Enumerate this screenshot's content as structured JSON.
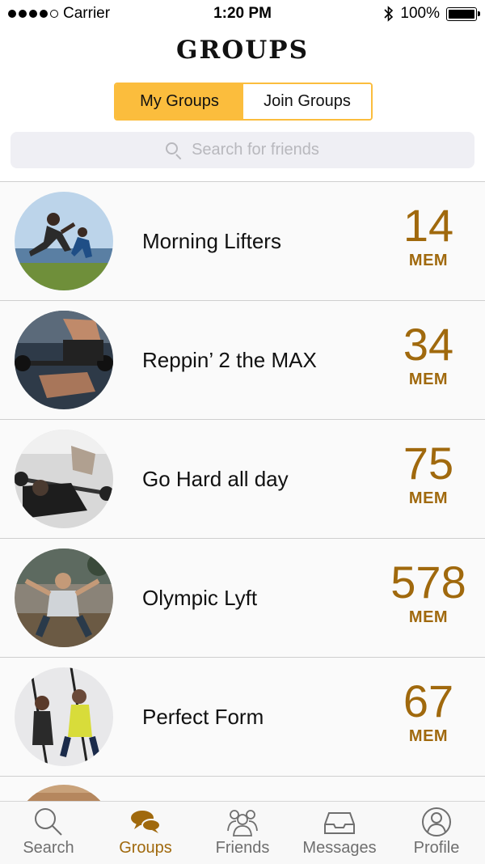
{
  "status_bar": {
    "carrier": "Carrier",
    "time": "1:20 PM",
    "battery": "100%",
    "icons": [
      "signal-dots-icon",
      "bluetooth-icon",
      "battery-icon"
    ]
  },
  "header": {
    "title": "GROUPS"
  },
  "segmented": {
    "my_groups": "My Groups",
    "join_groups": "Join Groups",
    "active": "my_groups"
  },
  "search": {
    "placeholder": "Search for friends"
  },
  "groups": [
    {
      "name": "Morning Lifters",
      "members": "14",
      "unit": "MEM"
    },
    {
      "name": "Reppin’ 2 the MAX",
      "members": "34",
      "unit": "MEM"
    },
    {
      "name": "Go Hard all day",
      "members": "75",
      "unit": "MEM"
    },
    {
      "name": "Olympic Lyft",
      "members": "578",
      "unit": "MEM"
    },
    {
      "name": "Perfect Form",
      "members": "67",
      "unit": "MEM"
    }
  ],
  "tabbar": {
    "items": [
      {
        "label": "Search",
        "icon": "search-icon"
      },
      {
        "label": "Groups",
        "icon": "chat-bubbles-icon",
        "active": true
      },
      {
        "label": "Friends",
        "icon": "people-icon"
      },
      {
        "label": "Messages",
        "icon": "inbox-tray-icon"
      },
      {
        "label": "Profile",
        "icon": "person-circle-icon"
      }
    ]
  },
  "colors": {
    "accent": "#fbbd3d",
    "count": "#a0690d"
  }
}
